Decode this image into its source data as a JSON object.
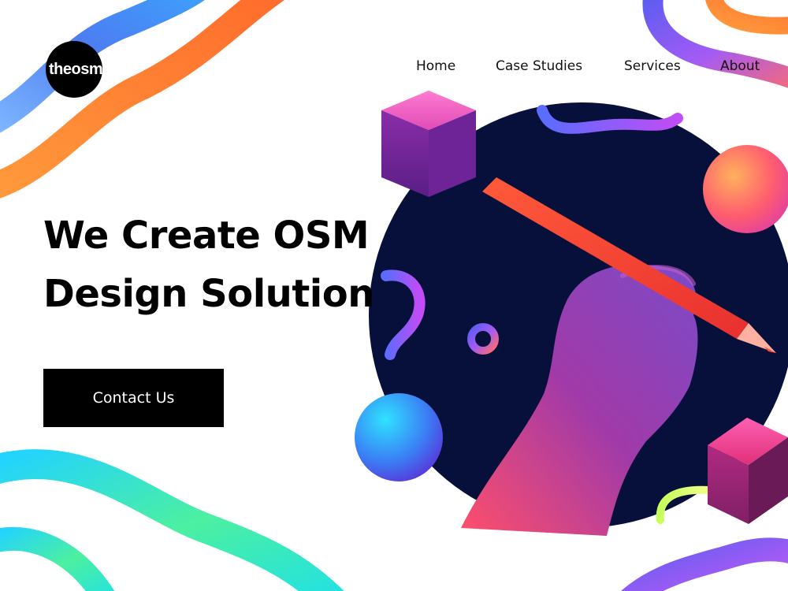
{
  "brand": {
    "logo_text": "theosm"
  },
  "nav": {
    "items": [
      "Home",
      "Case Studies",
      "Services",
      "About"
    ]
  },
  "hero": {
    "title_line1": "We Create OSM",
    "title_line2": "Design Solution",
    "cta_label": "Contact Us"
  },
  "colors": {
    "background": "#ffffff",
    "text": "#000000",
    "circle": "#07103a",
    "pencil": "#f2412a",
    "hand": "#8d3f9e",
    "swirl_blue": "#4d8cf5",
    "swirl_orange": "#fb8a35",
    "swirl_green": "#2ee39a",
    "swirl_purple": "#8a4cf2"
  },
  "illustration": {
    "description_icons": [
      "cube-icon",
      "sphere-icon",
      "pencil-icon",
      "hand-icon",
      "ring-icon",
      "swirl-icon"
    ]
  }
}
